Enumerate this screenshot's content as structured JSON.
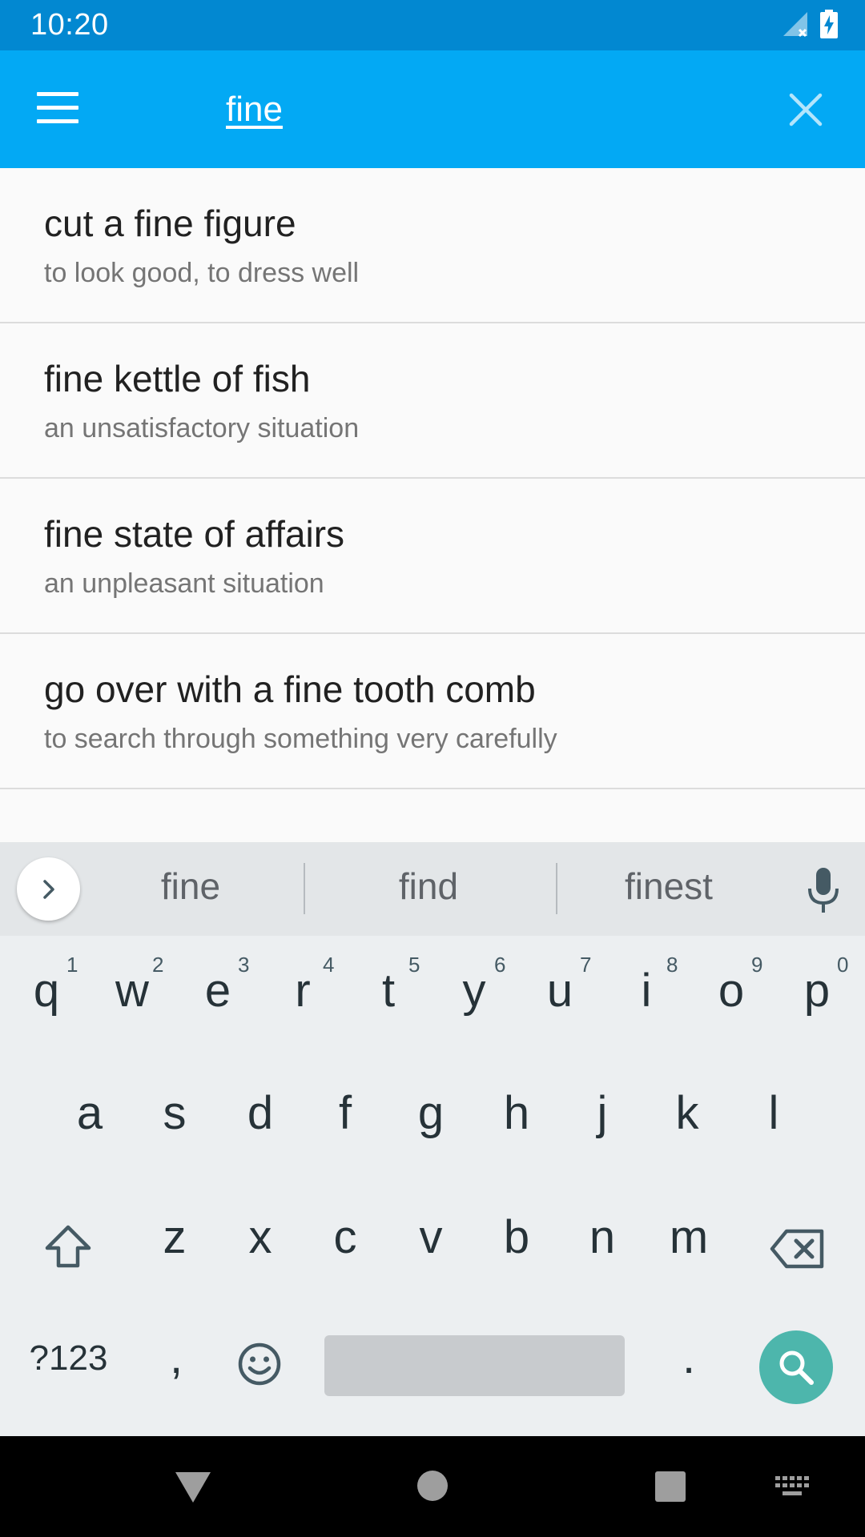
{
  "status_bar": {
    "time": "10:20",
    "icons": [
      "signal-icon",
      "battery-charging-icon"
    ]
  },
  "app_bar": {
    "menu_icon": "menu-icon",
    "search_value": "fine",
    "close_icon": "close-icon"
  },
  "results": [
    {
      "title": "cut a fine figure",
      "definition": "to look good, to dress well"
    },
    {
      "title": "fine kettle of fish",
      "definition": "an unsatisfactory situation"
    },
    {
      "title": "fine state of affairs",
      "definition": "an unpleasant situation"
    },
    {
      "title": "go over with a fine tooth comb",
      "definition": "to search through something very carefully"
    }
  ],
  "keyboard": {
    "suggestions": [
      "fine",
      "find",
      "finest"
    ],
    "row1": [
      "q",
      "w",
      "e",
      "r",
      "t",
      "y",
      "u",
      "i",
      "o",
      "p"
    ],
    "row1_hints": [
      "1",
      "2",
      "3",
      "4",
      "5",
      "6",
      "7",
      "8",
      "9",
      "0"
    ],
    "row2": [
      "a",
      "s",
      "d",
      "f",
      "g",
      "h",
      "j",
      "k",
      "l"
    ],
    "row3": [
      "z",
      "x",
      "c",
      "v",
      "b",
      "n",
      "m"
    ],
    "symbols_label": "?123",
    "comma": ",",
    "period": ".",
    "accent_color": "#4db6ac"
  },
  "colors": {
    "app_bar": "#03a9f4",
    "status_bar": "#0288d1"
  }
}
